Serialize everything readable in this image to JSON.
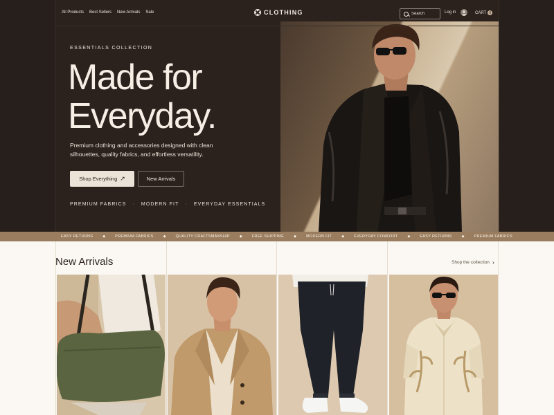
{
  "nav": {
    "links": [
      "All Products",
      "Best Sellers",
      "New Arrivals",
      "Sale"
    ],
    "brand": "CLOTHING",
    "search_placeholder": "Search",
    "login": "Log in",
    "cart_label": "CART",
    "cart_count": "0"
  },
  "hero": {
    "eyebrow": "ESSENTIALS COLLECTION",
    "headline_line1": "Made for",
    "headline_line2": "Everyday.",
    "description": "Premium clothing and accessories designed with clean silhouettes, quality fabrics, and effortless versatility.",
    "primary_button": "Shop Everything",
    "secondary_button": "New Arrivals",
    "features": [
      "PREMIUM FABRICS",
      "MODERN FIT",
      "EVERYDAY ESSENTIALS"
    ]
  },
  "marquee": {
    "items": [
      "EASY RETURNS",
      "PREMIUM FABRICS",
      "QUALITY CRAFTSMANSHIP",
      "FREE SHIPPING",
      "MODERN FIT",
      "EVERYDAY COMFORT",
      "EASY RETURNS",
      "PREMIUM FABRICS"
    ]
  },
  "arrivals": {
    "title": "New Arrivals",
    "shop_link": "Shop the collection",
    "products": [
      {
        "name": "olive-duffel-bag"
      },
      {
        "name": "camel-trench-coat"
      },
      {
        "name": "black-jogger-pants"
      },
      {
        "name": "cream-embroidered-shirt"
      }
    ]
  },
  "colors": {
    "hero_bg": "#2b221e",
    "marquee_bg": "#9a7d5e",
    "page_bg": "#fbf8f3",
    "text_light": "#f6efe6"
  }
}
